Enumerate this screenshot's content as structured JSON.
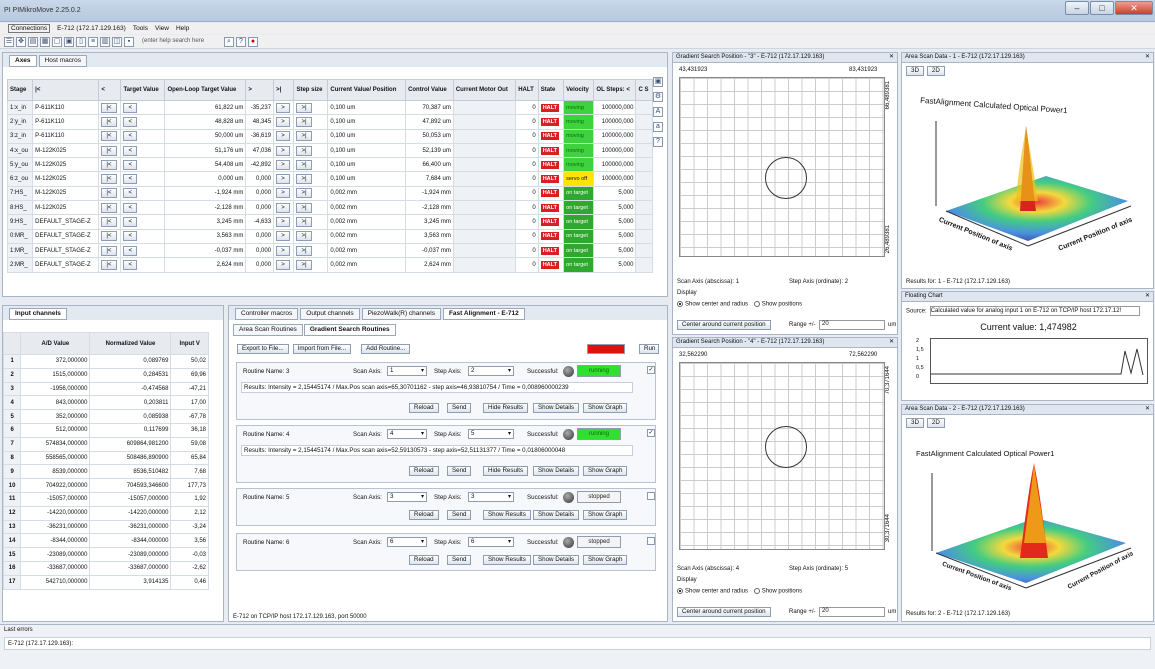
{
  "app": {
    "title": "PI PIMikroMove 2.25.0.2"
  },
  "menu": [
    "Connections",
    "E-712 (172.17.129.163)",
    "Tools",
    "View",
    "Help"
  ],
  "toolbar": {
    "help_placeholder": "(enter help search here"
  },
  "axes_tabs": [
    "Axes",
    "Host macros"
  ],
  "axes_headers": [
    "Stage",
    "|<",
    "<",
    "Target Value",
    "Open-Loop Target Value",
    ">",
    ">|",
    "Step size",
    "Current Value/ Position",
    "Control Value",
    "Current Motor Out",
    "HALT",
    "State",
    "Velocity",
    "OL Steps: <",
    "C S"
  ],
  "axes_rows": [
    [
      "1:x_in",
      "P-611K110",
      "61,822",
      "um",
      "-35,237",
      "0,100",
      "um",
      "70,387",
      "um",
      "0",
      "moving",
      "100000,000"
    ],
    [
      "2:y_in",
      "P-611K110",
      "48,828",
      "um",
      "48,345",
      "0,100",
      "um",
      "47,892",
      "um",
      "0",
      "moving",
      "100000,000"
    ],
    [
      "3:z_in",
      "P-611K110",
      "50,000",
      "um",
      "-36,619",
      "0,100",
      "um",
      "50,053",
      "um",
      "0",
      "moving",
      "100000,000"
    ],
    [
      "4:x_ou",
      "M-122K025",
      "51,176",
      "um",
      "47,036",
      "0,100",
      "um",
      "52,139",
      "um",
      "0",
      "moving",
      "100000,000"
    ],
    [
      "5:y_ou",
      "M-122K025",
      "54,408",
      "um",
      "-42,892",
      "0,100",
      "um",
      "66,400",
      "um",
      "0",
      "moving",
      "100000,000"
    ],
    [
      "6:z_ou",
      "M-122K025",
      "0,000",
      "um",
      "0,000",
      "0,100",
      "um",
      "7,684",
      "um",
      "0",
      "servo off",
      "100000,000"
    ],
    [
      "7:HS_",
      "M-122K025",
      "-1,924",
      "mm",
      "0,000",
      "0,002",
      "mm",
      "-1,924",
      "mm",
      "0",
      "on target",
      "5,000"
    ],
    [
      "8:HS_",
      "M-122K025",
      "-2,128",
      "mm",
      "0,000",
      "0,002",
      "mm",
      "-2,128",
      "mm",
      "0",
      "on target",
      "5,000"
    ],
    [
      "9:HS_",
      "DEFAULT_STAGE-Z",
      "3,245",
      "mm",
      "-4,633",
      "0,002",
      "mm",
      "3,245",
      "mm",
      "0",
      "on target",
      "5,000"
    ],
    [
      "0:MR_",
      "DEFAULT_STAGE-Z",
      "3,563",
      "mm",
      "0,000",
      "0,002",
      "mm",
      "3,563",
      "mm",
      "0",
      "on target",
      "5,000"
    ],
    [
      "1:MR_",
      "DEFAULT_STAGE-Z",
      "-0,037",
      "mm",
      "0,000",
      "0,002",
      "mm",
      "-0,037",
      "mm",
      "0",
      "on target",
      "5,000"
    ],
    [
      "2:MR_",
      "DEFAULT_STAGE-Z",
      "2,624",
      "mm",
      "0,000",
      "0,002",
      "mm",
      "2,624",
      "mm",
      "0",
      "on target",
      "5,000"
    ]
  ],
  "halt_label": "HALT",
  "input_panel": {
    "tab": "Input channels",
    "headers": [
      "A/D Value",
      "Normalized Value",
      "Input V"
    ],
    "rows": [
      [
        "1",
        "372,000000",
        "0,089769",
        "50,02"
      ],
      [
        "2",
        "1515,000000",
        "0,284531",
        "69,96"
      ],
      [
        "3",
        "-1956,000000",
        "-0,474568",
        "-47,21"
      ],
      [
        "4",
        "843,000000",
        "0,203811",
        "17,00"
      ],
      [
        "5",
        "352,000000",
        "0,085938",
        "-67,78"
      ],
      [
        "6",
        "512,000000",
        "0,117699",
        "36,18"
      ],
      [
        "7",
        "574834,000000",
        "609864,981200",
        "59,08"
      ],
      [
        "8",
        "558565,000000",
        "508486,890900",
        "65,84"
      ],
      [
        "9",
        "8539,000000",
        "8536,510482",
        "7,68"
      ],
      [
        "10",
        "704922,000000",
        "704593,346600",
        "177,73"
      ],
      [
        "11",
        "-15057,000000",
        "-15057,000000",
        "1,92"
      ],
      [
        "12",
        "-14220,000000",
        "-14220,000000",
        "2,12"
      ],
      [
        "13",
        "-36231,000000",
        "-36231,000000",
        "-3,24"
      ],
      [
        "14",
        "-8344,000000",
        "-8344,000000",
        "3,56"
      ],
      [
        "15",
        "-23089,000000",
        "-23089,000000",
        "-0,03"
      ],
      [
        "16",
        "-33687,000000",
        "-33687,000000",
        "-2,62"
      ],
      [
        "17",
        "542710,000000",
        "3,914135",
        "0,46"
      ]
    ]
  },
  "middle_tabs": [
    "Controller macros",
    "Output channels",
    "PiezoWalk(R) channels",
    "Fast Alignment - E-712"
  ],
  "fa_subtabs": [
    "Area Scan Routines",
    "Gradient Search Routines"
  ],
  "fa_buttons": {
    "export": "Export to File...",
    "import": "Import from File...",
    "add": "Add Routine...",
    "stop": "Stop",
    "run": "Run"
  },
  "labels": {
    "routine_name": "Routine Name:",
    "scan_axis": "Scan Axis:",
    "step_axis": "Step Axis:",
    "successful": "Successful:",
    "reload": "Reload",
    "send": "Send",
    "hide_results": "Hide Results",
    "show_results": "Show Results",
    "show_details": "Show Details",
    "show_graph": "Show Graph"
  },
  "routines": [
    {
      "name": "3",
      "scan": "1",
      "step": "2",
      "status": "running",
      "results": "Results: Intensity = 2,15445174 / Max.Pos scan axis=65,30701162 - step axis=46,93810754 / Time = 0,008960000239",
      "checked": true
    },
    {
      "name": "4",
      "scan": "4",
      "step": "5",
      "status": "running",
      "results": "Results: Intensity = 2,15445174 / Max.Pos scan axis=52,59130573 - step axis=52,51131377 / Time = 0,01806000048",
      "checked": true
    },
    {
      "name": "5",
      "scan": "3",
      "step": "3",
      "status": "stopped",
      "results": "",
      "checked": false
    },
    {
      "name": "6",
      "scan": "6",
      "step": "6",
      "status": "stopped",
      "results": "",
      "checked": false
    }
  ],
  "fa_status": "E-712 on TCP/IP host 172.17.129.163, port 50000",
  "gradient1": {
    "title": "Gradient Search Position - \"3\" - E-712 (172.17.129.163)",
    "x_min": "43,431923",
    "x_max": "83,431923",
    "y_max": "66,489381",
    "y_min": "26,489381",
    "scan_axis": "Scan Axis (abscissa): 1",
    "step_axis": "Step Axis (ordinate): 2"
  },
  "gradient2": {
    "title": "Gradient Search Position - \"4\" - E-712 (172.17.129.163)",
    "x_min": "32,562290",
    "x_max": "72,562290",
    "y_max": "70,371644",
    "y_min": "30,371644",
    "scan_axis": "Scan Axis (abscissa): 4",
    "step_axis": "Step Axis (ordinate): 5"
  },
  "display": {
    "label": "Display",
    "opt1": "Show center and radius",
    "opt2": "Show positions",
    "center_btn": "Center around current position",
    "range": "Range +/-",
    "range_val": "20",
    "unit": "um"
  },
  "area1": {
    "title": "Area Scan Data - 1 - E-712 (172.17.129.163)",
    "plot_title": "FastAlignment Calculated Optical Power1",
    "results": "Results for:   1 - E-712 (172.17.129.163)",
    "xlab": "Current Position of axis",
    "ylab": "Current Position of axis"
  },
  "area2": {
    "title": "Area Scan Data - 2 - E-712 (172.17.129.163)",
    "plot_title": "FastAlignment Calculated Optical Power1",
    "results": "Results for:   2 - E-712 (172.17.129.163)",
    "xlab": "Current Position of axis",
    "ylab": "Current Position of axis"
  },
  "view_btns": [
    "3D",
    "2D"
  ],
  "floating": {
    "title": "Floating Chart",
    "source_label": "Source:",
    "source": "Calculated value for analog input 1 on E-712 on TCP/IP host 172.17.12!",
    "current": "Current value: 1,474982",
    "yticks": [
      "2",
      "1,5",
      "1",
      "0,5",
      "0"
    ]
  },
  "last_errors": {
    "title": "Last errors",
    "entry": "E-712 (172.17.129.163):"
  }
}
